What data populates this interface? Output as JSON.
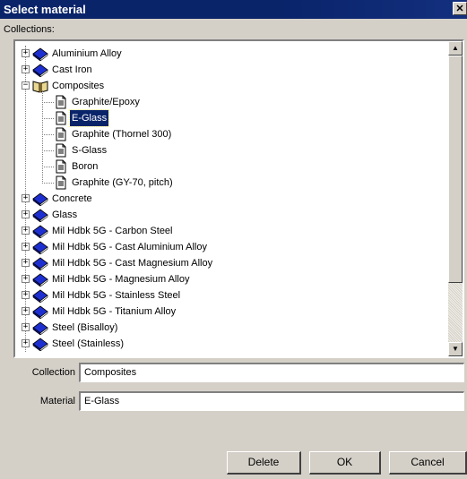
{
  "window": {
    "title": "Select material",
    "close_glyph": "✕"
  },
  "collections_label": "Collections:",
  "tree": {
    "items": [
      {
        "label": "Aluminium Alloy",
        "level": 0,
        "expander": "+",
        "icon": "book-closed-icon"
      },
      {
        "label": "Cast Iron",
        "level": 0,
        "expander": "+",
        "icon": "book-closed-icon"
      },
      {
        "label": "Composites",
        "level": 0,
        "expander": "−",
        "icon": "book-open-icon"
      },
      {
        "label": "Graphite/Epoxy",
        "level": 1,
        "icon": "document-icon"
      },
      {
        "label": "E-Glass",
        "level": 1,
        "icon": "document-icon",
        "selected": true
      },
      {
        "label": "Graphite (Thornel 300)",
        "level": 1,
        "icon": "document-icon"
      },
      {
        "label": "S-Glass",
        "level": 1,
        "icon": "document-icon"
      },
      {
        "label": "Boron",
        "level": 1,
        "icon": "document-icon"
      },
      {
        "label": "Graphite (GY-70, pitch)",
        "level": 1,
        "icon": "document-icon"
      },
      {
        "label": "Concrete",
        "level": 0,
        "expander": "+",
        "icon": "book-closed-icon"
      },
      {
        "label": "Glass",
        "level": 0,
        "expander": "+",
        "icon": "book-closed-icon"
      },
      {
        "label": "Mil Hdbk 5G - Carbon Steel",
        "level": 0,
        "expander": "+",
        "icon": "book-closed-icon"
      },
      {
        "label": "Mil Hdbk 5G - Cast Aluminium Alloy",
        "level": 0,
        "expander": "+",
        "icon": "book-closed-icon"
      },
      {
        "label": "Mil Hdbk 5G - Cast Magnesium Alloy",
        "level": 0,
        "expander": "+",
        "icon": "book-closed-icon"
      },
      {
        "label": "Mil Hdbk 5G - Magnesium Alloy",
        "level": 0,
        "expander": "+",
        "icon": "book-closed-icon"
      },
      {
        "label": "Mil Hdbk 5G - Stainless Steel",
        "level": 0,
        "expander": "+",
        "icon": "book-closed-icon"
      },
      {
        "label": "Mil Hdbk 5G - Titanium Alloy",
        "level": 0,
        "expander": "+",
        "icon": "book-closed-icon"
      },
      {
        "label": "Steel (Bisalloy)",
        "level": 0,
        "expander": "+",
        "icon": "book-closed-icon"
      },
      {
        "label": "Steel (Stainless)",
        "level": 0,
        "expander": "+",
        "icon": "book-closed-icon"
      }
    ],
    "scrollbar": {
      "up_glyph": "▲",
      "down_glyph": "▼"
    }
  },
  "form": {
    "collection_label": "Collection",
    "collection_value": "Composites",
    "material_label": "Material",
    "material_value": "E-Glass"
  },
  "buttons": {
    "delete": "Delete",
    "ok": "OK",
    "cancel": "Cancel"
  },
  "colors": {
    "title_bar": "#0a246a",
    "face": "#d4d0c8",
    "book_blue": "#1e2fd0",
    "selection": "#0a246a"
  }
}
